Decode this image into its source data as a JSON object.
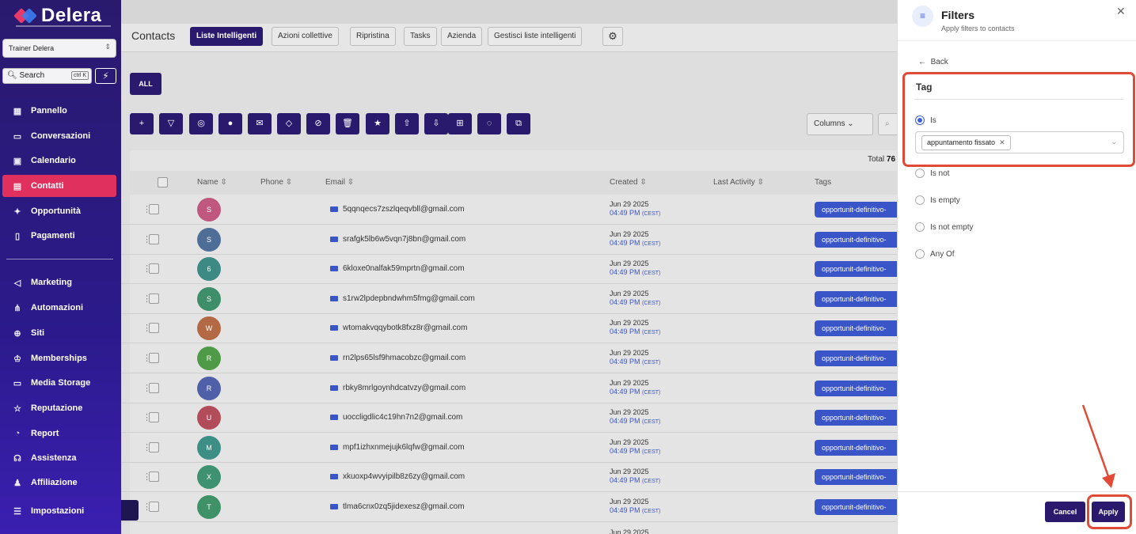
{
  "brand": {
    "name": "Delera"
  },
  "sidebar": {
    "account": "Trainer Delera",
    "search_label": "Search",
    "search_kbd": "ctrl K",
    "items": [
      {
        "label": "Pannello",
        "icon": "grid-icon"
      },
      {
        "label": "Conversazioni",
        "icon": "chat-icon"
      },
      {
        "label": "Calendario",
        "icon": "calendar-icon"
      },
      {
        "label": "Contatti",
        "icon": "contacts-icon"
      },
      {
        "label": "Opportunità",
        "icon": "target-icon"
      },
      {
        "label": "Pagamenti",
        "icon": "payment-icon"
      },
      {
        "label": "Marketing",
        "icon": "megaphone-icon"
      },
      {
        "label": "Automazioni",
        "icon": "flow-icon"
      },
      {
        "label": "Siti",
        "icon": "globe-icon"
      },
      {
        "label": "Memberships",
        "icon": "crown-icon"
      },
      {
        "label": "Media Storage",
        "icon": "storage-icon"
      },
      {
        "label": "Reputazione",
        "icon": "star-icon"
      },
      {
        "label": "Report",
        "icon": "chart-icon"
      },
      {
        "label": "Assistenza",
        "icon": "headset-icon"
      },
      {
        "label": "Affiliazione",
        "icon": "affiliate-icon"
      },
      {
        "label": "Impostazioni",
        "icon": "sliders-icon"
      }
    ]
  },
  "header": {
    "title": "Contacts",
    "tabs": [
      "Liste Intelligenti",
      "Azioni collettive",
      "Ripristina",
      "Tasks",
      "Azienda",
      "Gestisci liste intelligenti"
    ]
  },
  "toolbar": {
    "all_label": "ALL",
    "columns_label": "Columns",
    "total_label": "Total",
    "total_value": "76"
  },
  "table": {
    "headers": [
      "Name",
      "Phone",
      "Email",
      "Created",
      "Last Activity",
      "Tags"
    ],
    "rows": [
      {
        "initial": "S",
        "color": "#c0577e",
        "email": "5qqnqecs7zszlqeqvbll@gmail.com",
        "date": "Jun 29 2025",
        "time": "04:49 PM",
        "tz": "(CEST)",
        "tag": "opportunit-definitivo-"
      },
      {
        "initial": "S",
        "color": "#4f6e97",
        "email": "srafgk5lb6w5vqn7j8bn@gmail.com",
        "date": "Jun 29 2025",
        "time": "04:49 PM",
        "tz": "(CEST)",
        "tag": "opportunit-definitivo-"
      },
      {
        "initial": "6",
        "color": "#3d8a85",
        "email": "6kloxe0nalfak59mprtn@gmail.com",
        "date": "Jun 29 2025",
        "time": "04:49 PM",
        "tz": "(CEST)",
        "tag": "opportunit-definitivo-"
      },
      {
        "initial": "S",
        "color": "#3f8e6a",
        "email": "s1rw2lpdepbndwhm5fmg@gmail.com",
        "date": "Jun 29 2025",
        "time": "04:49 PM",
        "tz": "(CEST)",
        "tag": "opportunit-definitivo-"
      },
      {
        "initial": "W",
        "color": "#b36a44",
        "email": "wtomakvqqybotk8fxz8r@gmail.com",
        "date": "Jun 29 2025",
        "time": "04:49 PM",
        "tz": "(CEST)",
        "tag": "opportunit-definitivo-"
      },
      {
        "initial": "R",
        "color": "#4e9a47",
        "email": "rn2lps65lsf9hmacobzc@gmail.com",
        "date": "Jun 29 2025",
        "time": "04:49 PM",
        "tz": "(CEST)",
        "tag": "opportunit-definitivo-"
      },
      {
        "initial": "R",
        "color": "#4f5fa8",
        "email": "rbky8mrlgoynhdcatvzy@gmail.com",
        "date": "Jun 29 2025",
        "time": "04:49 PM",
        "tz": "(CEST)",
        "tag": "opportunit-definitivo-"
      },
      {
        "initial": "U",
        "color": "#b24b5a",
        "email": "uoccligdlic4c19hn7n2@gmail.com",
        "date": "Jun 29 2025",
        "time": "04:49 PM",
        "tz": "(CEST)",
        "tag": "opportunit-definitivo-"
      },
      {
        "initial": "M",
        "color": "#3d8f86",
        "email": "mpf1izhxnmejujk6lqfw@gmail.com",
        "date": "Jun 29 2025",
        "time": "04:49 PM",
        "tz": "(CEST)",
        "tag": "opportunit-definitivo-"
      },
      {
        "initial": "X",
        "color": "#3e9271",
        "email": "xkuoxp4wvyipilb8z6zy@gmail.com",
        "date": "Jun 29 2025",
        "time": "04:49 PM",
        "tz": "(CEST)",
        "tag": "opportunit-definitivo-"
      },
      {
        "initial": "T",
        "color": "#3f9268",
        "email": "tlma6cnx0zq5jidexesz@gmail.com",
        "date": "Jun 29 2025",
        "time": "04:49 PM",
        "tz": "(CEST)",
        "tag": "opportunit-definitivo-"
      }
    ],
    "partial_row_date": "Jun 29 2025"
  },
  "filters": {
    "title": "Filters",
    "subtitle": "Apply filters to contacts",
    "back": "Back",
    "field": "Tag",
    "options": [
      "Is",
      "Is not",
      "Is empty",
      "Is not empty",
      "Any Of"
    ],
    "selected_option": "Is",
    "selected_tag": "appuntamento fissato",
    "cancel": "Cancel",
    "apply": "Apply",
    "icon": "filter-icon"
  },
  "colors": {
    "brand_dark": "#2a1a6e",
    "active_nav": "#e0305e",
    "accent_blue": "#3a55c8",
    "annotation_red": "#e04a36"
  }
}
